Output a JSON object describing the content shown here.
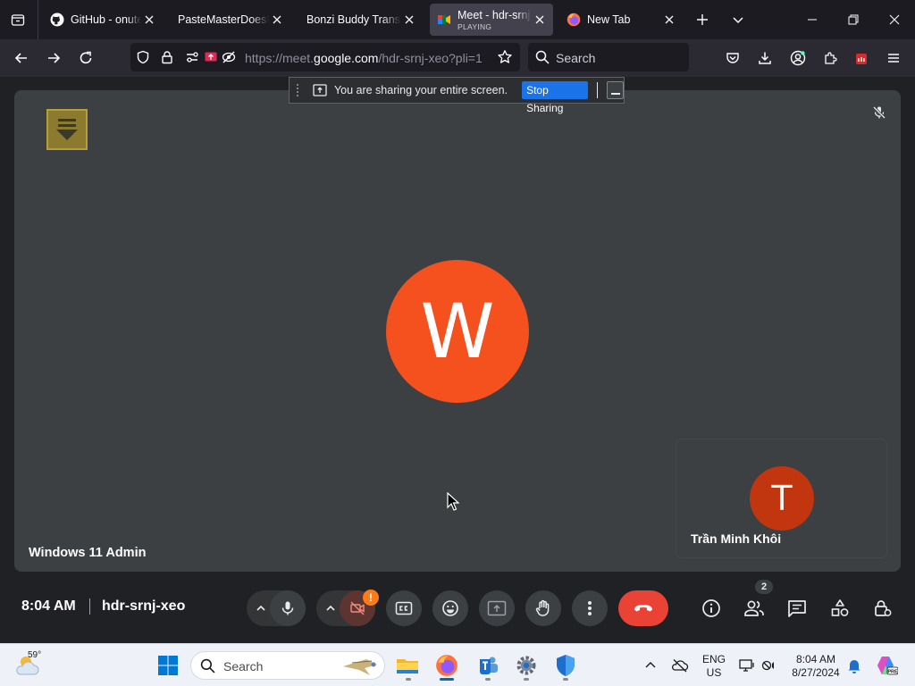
{
  "browser": {
    "tabs": [
      {
        "title": "GitHub - onuter",
        "favicon": "github-icon",
        "active": false
      },
      {
        "title": "PasteMasterDoesMa",
        "favicon": "",
        "active": false
      },
      {
        "title": "Bonzi Buddy Transla",
        "favicon": "",
        "active": false
      },
      {
        "title": "Meet - hdr-srnj",
        "subtitle": "PLAYING",
        "favicon": "meet-icon",
        "active": true
      },
      {
        "title": "New Tab",
        "favicon": "firefox-icon",
        "active": false
      }
    ],
    "url": {
      "prefix": "https://meet.",
      "domain": "google.com",
      "path": "/hdr-srnj-xeo?pli=1"
    },
    "search_placeholder": "Search",
    "extension_badge": "38"
  },
  "share_bar": {
    "message": "You are sharing your entire screen.",
    "stop_label": "Stop Sharing"
  },
  "meeting": {
    "main_participant": {
      "initial": "W",
      "name": "Windows 11 Admin",
      "color": "#f4511e"
    },
    "side_participant": {
      "initial": "T",
      "name": "Trần Minh Khôi",
      "color": "#c1350f"
    },
    "time": "8:04 AM",
    "code": "hdr-srnj-xeo",
    "camera_warning": "!",
    "participant_count": "2"
  },
  "taskbar": {
    "temperature": "59°",
    "search_placeholder": "Search",
    "lang_line1": "ENG",
    "lang_line2": "US",
    "time": "8:04 AM",
    "date": "8/27/2024"
  },
  "colors": {
    "accent": "#1a73e8",
    "leave": "#ea4335",
    "warning": "#fa7b17"
  }
}
